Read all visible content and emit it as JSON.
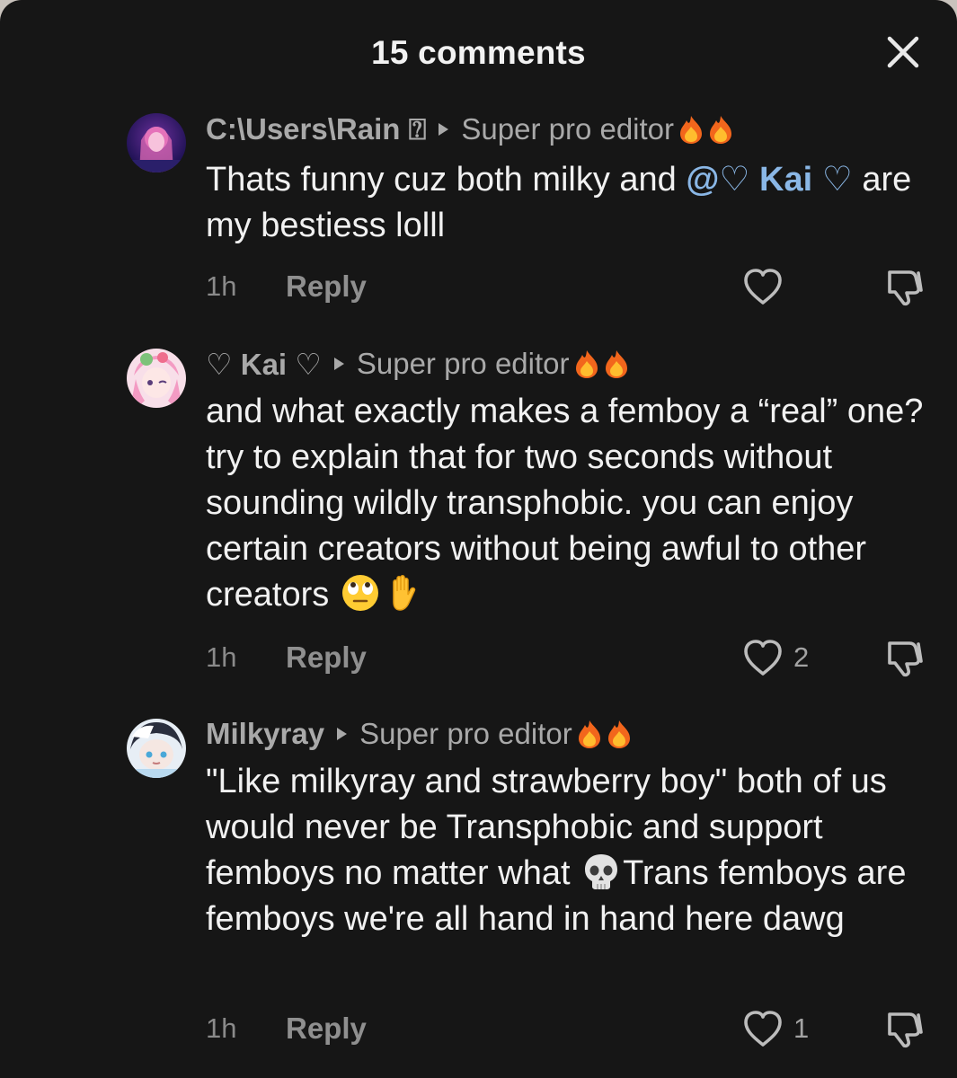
{
  "header": {
    "title": "15 comments"
  },
  "colors": {
    "background": "#161616",
    "text_primary": "#f1f1f1",
    "text_secondary": "#a9a9a9",
    "mention": "#8ab7e6"
  },
  "comments": [
    {
      "username": "C:\\Users\\Rain ⍰",
      "video_label": "Super pro editor",
      "text_before": "Thats funny cuz both milky and ",
      "mention": "@♡ Kai ♡",
      "text_after": " are my bestiess lolll",
      "time": "1h",
      "reply_label": "Reply",
      "likes": ""
    },
    {
      "username": "♡ Kai ♡",
      "video_label": "Super pro editor",
      "text": "and what exactly makes a femboy a “real” one? try to explain that for two seconds without sounding wildly transphobic. you can enjoy certain creators without being awful to other creators",
      "emojis": [
        "eye-roll-emoji",
        "raised-hand-emoji"
      ],
      "time": "1h",
      "reply_label": "Reply",
      "likes": "2"
    },
    {
      "username": "Milkyray",
      "video_label": "Super pro editor",
      "text_before": "\"Like milkyray and strawberry boy\" both of us would never be Transphobic and support femboys no matter what ",
      "emoji": "skull-emoji",
      "text_after": "Trans femboys are femboys we're all hand in hand here dawg",
      "time": "1h",
      "reply_label": "Reply",
      "likes": "1"
    }
  ]
}
